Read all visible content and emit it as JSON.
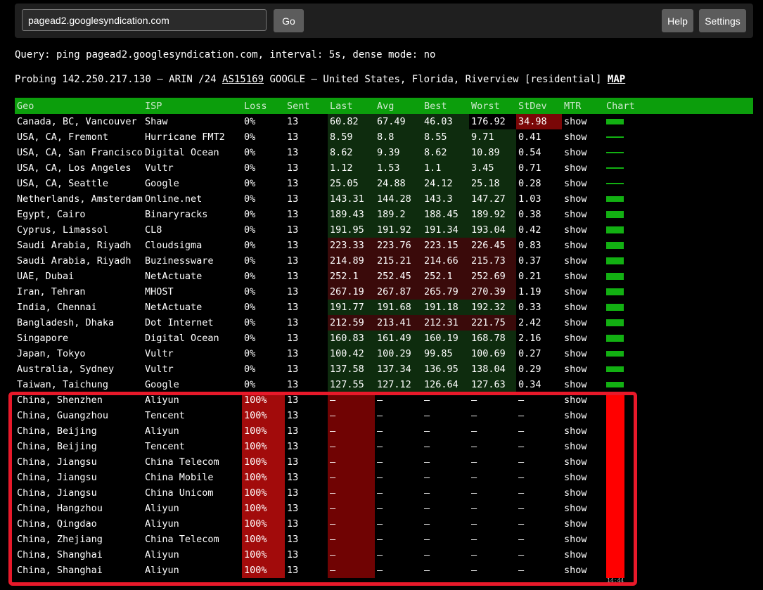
{
  "toolbar": {
    "url_value": "pagead2.googlesyndication.com",
    "go_label": "Go",
    "help_label": "Help",
    "settings_label": "Settings"
  },
  "query_text": "Query: ping pagead2.googlesyndication.com, interval: 5s, dense mode: no",
  "probe": {
    "prefix": "Probing 142.250.217.130 — ARIN /24 ",
    "asn": "AS15169",
    "middle": " GOOGLE — United States, Florida, Riverview [residential] ",
    "map_label": "MAP"
  },
  "columns": [
    "Geo",
    "ISP",
    "Loss",
    "Sent",
    "Last",
    "Avg",
    "Best",
    "Worst",
    "StDev",
    "MTR",
    "Chart"
  ],
  "rows": [
    {
      "geo": "Canada, BC, Vancouver",
      "isp": "Shaw",
      "loss": "0%",
      "sent": "13",
      "last": "60.82",
      "avg": "67.49",
      "best": "46.03",
      "worst": "176.92",
      "stdev": "34.98",
      "mtr": "show"
    },
    {
      "geo": "USA, CA, Fremont",
      "isp": "Hurricane FMT2",
      "loss": "0%",
      "sent": "13",
      "last": "8.59",
      "avg": "8.8",
      "best": "8.55",
      "worst": "9.71",
      "stdev": "0.41",
      "mtr": "show"
    },
    {
      "geo": "USA, CA, San Francisco",
      "isp": "Digital Ocean",
      "loss": "0%",
      "sent": "13",
      "last": "8.62",
      "avg": "9.39",
      "best": "8.62",
      "worst": "10.89",
      "stdev": "0.54",
      "mtr": "show"
    },
    {
      "geo": "USA, CA, Los Angeles",
      "isp": "Vultr",
      "loss": "0%",
      "sent": "13",
      "last": "1.12",
      "avg": "1.53",
      "best": "1.1",
      "worst": "3.45",
      "stdev": "0.71",
      "mtr": "show"
    },
    {
      "geo": "USA, CA, Seattle",
      "isp": "Google",
      "loss": "0%",
      "sent": "13",
      "last": "25.05",
      "avg": "24.88",
      "best": "24.12",
      "worst": "25.18",
      "stdev": "0.28",
      "mtr": "show"
    },
    {
      "geo": "Netherlands, Amsterdam",
      "isp": "Online.net",
      "loss": "0%",
      "sent": "13",
      "last": "143.31",
      "avg": "144.28",
      "best": "143.3",
      "worst": "147.27",
      "stdev": "1.03",
      "mtr": "show"
    },
    {
      "geo": "Egypt, Cairo",
      "isp": "Binaryracks",
      "loss": "0%",
      "sent": "13",
      "last": "189.43",
      "avg": "189.2",
      "best": "188.45",
      "worst": "189.92",
      "stdev": "0.38",
      "mtr": "show"
    },
    {
      "geo": "Cyprus, Limassol",
      "isp": "CL8",
      "loss": "0%",
      "sent": "13",
      "last": "191.95",
      "avg": "191.92",
      "best": "191.34",
      "worst": "193.04",
      "stdev": "0.42",
      "mtr": "show"
    },
    {
      "geo": "Saudi Arabia, Riyadh",
      "isp": "Cloudsigma",
      "loss": "0%",
      "sent": "13",
      "last": "223.33",
      "avg": "223.76",
      "best": "223.15",
      "worst": "226.45",
      "stdev": "0.83",
      "mtr": "show"
    },
    {
      "geo": "Saudi Arabia, Riyadh",
      "isp": "Buzinessware",
      "loss": "0%",
      "sent": "13",
      "last": "214.89",
      "avg": "215.21",
      "best": "214.66",
      "worst": "215.73",
      "stdev": "0.37",
      "mtr": "show"
    },
    {
      "geo": "UAE, Dubai",
      "isp": "NetActuate",
      "loss": "0%",
      "sent": "13",
      "last": "252.1",
      "avg": "252.45",
      "best": "252.1",
      "worst": "252.69",
      "stdev": "0.21",
      "mtr": "show"
    },
    {
      "geo": "Iran, Tehran",
      "isp": "MHOST",
      "loss": "0%",
      "sent": "13",
      "last": "267.19",
      "avg": "267.87",
      "best": "265.79",
      "worst": "270.39",
      "stdev": "1.19",
      "mtr": "show"
    },
    {
      "geo": "India, Chennai",
      "isp": "NetActuate",
      "loss": "0%",
      "sent": "13",
      "last": "191.77",
      "avg": "191.68",
      "best": "191.18",
      "worst": "192.32",
      "stdev": "0.33",
      "mtr": "show"
    },
    {
      "geo": "Bangladesh, Dhaka",
      "isp": "Dot Internet",
      "loss": "0%",
      "sent": "13",
      "last": "212.59",
      "avg": "213.41",
      "best": "212.31",
      "worst": "221.75",
      "stdev": "2.42",
      "mtr": "show"
    },
    {
      "geo": "Singapore",
      "isp": "Digital Ocean",
      "loss": "0%",
      "sent": "13",
      "last": "160.83",
      "avg": "161.49",
      "best": "160.19",
      "worst": "168.78",
      "stdev": "2.16",
      "mtr": "show"
    },
    {
      "geo": "Japan, Tokyo",
      "isp": "Vultr",
      "loss": "0%",
      "sent": "13",
      "last": "100.42",
      "avg": "100.29",
      "best": "99.85",
      "worst": "100.69",
      "stdev": "0.27",
      "mtr": "show"
    },
    {
      "geo": "Australia, Sydney",
      "isp": "Vultr",
      "loss": "0%",
      "sent": "13",
      "last": "137.58",
      "avg": "137.34",
      "best": "136.95",
      "worst": "138.04",
      "stdev": "0.29",
      "mtr": "show"
    },
    {
      "geo": "Taiwan, Taichung",
      "isp": "Google",
      "loss": "0%",
      "sent": "13",
      "last": "127.55",
      "avg": "127.12",
      "best": "126.64",
      "worst": "127.63",
      "stdev": "0.34",
      "mtr": "show"
    },
    {
      "geo": "China, Shenzhen",
      "isp": "Aliyun",
      "loss": "100%",
      "sent": "13",
      "last": "–",
      "avg": "–",
      "best": "–",
      "worst": "–",
      "stdev": "–",
      "mtr": "show"
    },
    {
      "geo": "China, Guangzhou",
      "isp": "Tencent",
      "loss": "100%",
      "sent": "13",
      "last": "–",
      "avg": "–",
      "best": "–",
      "worst": "–",
      "stdev": "–",
      "mtr": "show"
    },
    {
      "geo": "China, Beijing",
      "isp": "Aliyun",
      "loss": "100%",
      "sent": "13",
      "last": "–",
      "avg": "–",
      "best": "–",
      "worst": "–",
      "stdev": "–",
      "mtr": "show"
    },
    {
      "geo": "China, Beijing",
      "isp": "Tencent",
      "loss": "100%",
      "sent": "13",
      "last": "–",
      "avg": "–",
      "best": "–",
      "worst": "–",
      "stdev": "–",
      "mtr": "show"
    },
    {
      "geo": "China, Jiangsu",
      "isp": "China Telecom",
      "loss": "100%",
      "sent": "13",
      "last": "–",
      "avg": "–",
      "best": "–",
      "worst": "–",
      "stdev": "–",
      "mtr": "show"
    },
    {
      "geo": "China, Jiangsu",
      "isp": "China Mobile",
      "loss": "100%",
      "sent": "13",
      "last": "–",
      "avg": "–",
      "best": "–",
      "worst": "–",
      "stdev": "–",
      "mtr": "show"
    },
    {
      "geo": "China, Jiangsu",
      "isp": "China Unicom",
      "loss": "100%",
      "sent": "13",
      "last": "–",
      "avg": "–",
      "best": "–",
      "worst": "–",
      "stdev": "–",
      "mtr": "show"
    },
    {
      "geo": "China, Hangzhou",
      "isp": "Aliyun",
      "loss": "100%",
      "sent": "13",
      "last": "–",
      "avg": "–",
      "best": "–",
      "worst": "–",
      "stdev": "–",
      "mtr": "show"
    },
    {
      "geo": "China, Qingdao",
      "isp": "Aliyun",
      "loss": "100%",
      "sent": "13",
      "last": "–",
      "avg": "–",
      "best": "–",
      "worst": "–",
      "stdev": "–",
      "mtr": "show"
    },
    {
      "geo": "China, Zhejiang",
      "isp": "China Telecom",
      "loss": "100%",
      "sent": "13",
      "last": "–",
      "avg": "–",
      "best": "–",
      "worst": "–",
      "stdev": "–",
      "mtr": "show"
    },
    {
      "geo": "China, Shanghai",
      "isp": "Aliyun",
      "loss": "100%",
      "sent": "13",
      "last": "–",
      "avg": "–",
      "best": "–",
      "worst": "–",
      "stdev": "–",
      "mtr": "show"
    },
    {
      "geo": "China, Shanghai",
      "isp": "Aliyun",
      "loss": "100%",
      "sent": "13",
      "last": "–",
      "avg": "–",
      "best": "–",
      "worst": "–",
      "stdev": "–",
      "mtr": "show"
    }
  ],
  "chart_time_label": "14:44"
}
